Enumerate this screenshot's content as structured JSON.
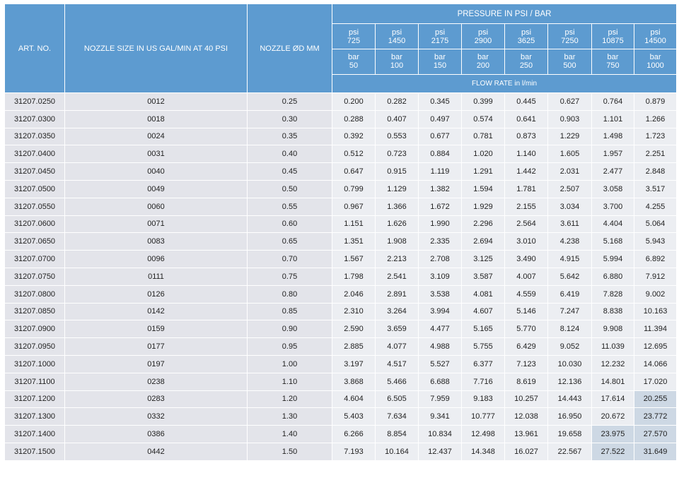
{
  "table": {
    "headers": {
      "art_no": "ART. NO.",
      "nozzle_size": "NOZZLE SIZE IN US GAL/MIN AT 40 PSI",
      "nozzle_diameter": "NOZZLE ØD MM",
      "pressure_group": "PRESSURE IN PSI / BAR",
      "flow_rate": "FLOW RATE in l/min"
    },
    "unit_psi": "psi",
    "unit_bar": "bar",
    "psi_values": [
      "725",
      "1450",
      "2175",
      "2900",
      "3625",
      "7250",
      "10875",
      "14500"
    ],
    "bar_values": [
      "50",
      "100",
      "150",
      "200",
      "250",
      "500",
      "750",
      "1000"
    ],
    "rows": [
      {
        "art": "31207.0250",
        "size": "0012",
        "dia": "0.25",
        "flows": [
          "0.200",
          "0.282",
          "0.345",
          "0.399",
          "0.445",
          "0.627",
          "0.764",
          "0.879"
        ]
      },
      {
        "art": "31207.0300",
        "size": "0018",
        "dia": "0.30",
        "flows": [
          "0.288",
          "0.407",
          "0.497",
          "0.574",
          "0.641",
          "0.903",
          "1.101",
          "1.266"
        ]
      },
      {
        "art": "31207.0350",
        "size": "0024",
        "dia": "0.35",
        "flows": [
          "0.392",
          "0.553",
          "0.677",
          "0.781",
          "0.873",
          "1.229",
          "1.498",
          "1.723"
        ]
      },
      {
        "art": "31207.0400",
        "size": "0031",
        "dia": "0.40",
        "flows": [
          "0.512",
          "0.723",
          "0.884",
          "1.020",
          "1.140",
          "1.605",
          "1.957",
          "2.251"
        ]
      },
      {
        "art": "31207.0450",
        "size": "0040",
        "dia": "0.45",
        "flows": [
          "0.647",
          "0.915",
          "1.119",
          "1.291",
          "1.442",
          "2.031",
          "2.477",
          "2.848"
        ]
      },
      {
        "art": "31207.0500",
        "size": "0049",
        "dia": "0.50",
        "flows": [
          "0.799",
          "1.129",
          "1.382",
          "1.594",
          "1.781",
          "2.507",
          "3.058",
          "3.517"
        ]
      },
      {
        "art": "31207.0550",
        "size": "0060",
        "dia": "0.55",
        "flows": [
          "0.967",
          "1.366",
          "1.672",
          "1.929",
          "2.155",
          "3.034",
          "3.700",
          "4.255"
        ]
      },
      {
        "art": "31207.0600",
        "size": "0071",
        "dia": "0.60",
        "flows": [
          "1.151",
          "1.626",
          "1.990",
          "2.296",
          "2.564",
          "3.611",
          "4.404",
          "5.064"
        ]
      },
      {
        "art": "31207.0650",
        "size": "0083",
        "dia": "0.65",
        "flows": [
          "1.351",
          "1.908",
          "2.335",
          "2.694",
          "3.010",
          "4.238",
          "5.168",
          "5.943"
        ]
      },
      {
        "art": "31207.0700",
        "size": "0096",
        "dia": "0.70",
        "flows": [
          "1.567",
          "2.213",
          "2.708",
          "3.125",
          "3.490",
          "4.915",
          "5.994",
          "6.892"
        ]
      },
      {
        "art": "31207.0750",
        "size": "0111",
        "dia": "0.75",
        "flows": [
          "1.798",
          "2.541",
          "3.109",
          "3.587",
          "4.007",
          "5.642",
          "6.880",
          "7.912"
        ]
      },
      {
        "art": "31207.0800",
        "size": "0126",
        "dia": "0.80",
        "flows": [
          "2.046",
          "2.891",
          "3.538",
          "4.081",
          "4.559",
          "6.419",
          "7.828",
          "9.002"
        ]
      },
      {
        "art": "31207.0850",
        "size": "0142",
        "dia": "0.85",
        "flows": [
          "2.310",
          "3.264",
          "3.994",
          "4.607",
          "5.146",
          "7.247",
          "8.838",
          "10.163"
        ]
      },
      {
        "art": "31207.0900",
        "size": "0159",
        "dia": "0.90",
        "flows": [
          "2.590",
          "3.659",
          "4.477",
          "5.165",
          "5.770",
          "8.124",
          "9.908",
          "11.394"
        ]
      },
      {
        "art": "31207.0950",
        "size": "0177",
        "dia": "0.95",
        "flows": [
          "2.885",
          "4.077",
          "4.988",
          "5.755",
          "6.429",
          "9.052",
          "11.039",
          "12.695"
        ]
      },
      {
        "art": "31207.1000",
        "size": "0197",
        "dia": "1.00",
        "flows": [
          "3.197",
          "4.517",
          "5.527",
          "6.377",
          "7.123",
          "10.030",
          "12.232",
          "14.066"
        ]
      },
      {
        "art": "31207.1100",
        "size": "0238",
        "dia": "1.10",
        "flows": [
          "3.868",
          "5.466",
          "6.688",
          "7.716",
          "8.619",
          "12.136",
          "14.801",
          "17.020"
        ]
      },
      {
        "art": "31207.1200",
        "size": "0283",
        "dia": "1.20",
        "flows": [
          "4.604",
          "6.505",
          "7.959",
          "9.183",
          "10.257",
          "14.443",
          "17.614",
          "20.255"
        ]
      },
      {
        "art": "31207.1300",
        "size": "0332",
        "dia": "1.30",
        "flows": [
          "5.403",
          "7.634",
          "9.341",
          "10.777",
          "12.038",
          "16.950",
          "20.672",
          "23.772"
        ]
      },
      {
        "art": "31207.1400",
        "size": "0386",
        "dia": "1.40",
        "flows": [
          "6.266",
          "8.854",
          "10.834",
          "12.498",
          "13.961",
          "19.658",
          "23.975",
          "27.570"
        ]
      },
      {
        "art": "31207.1500",
        "size": "0442",
        "dia": "1.50",
        "flows": [
          "7.193",
          "10.164",
          "12.437",
          "14.348",
          "16.027",
          "22.567",
          "27.522",
          "31.649"
        ]
      }
    ],
    "highlighted_cells": [
      {
        "row": 17,
        "col": 7
      },
      {
        "row": 18,
        "col": 7
      },
      {
        "row": 19,
        "col": 6
      },
      {
        "row": 19,
        "col": 7
      },
      {
        "row": 20,
        "col": 6
      },
      {
        "row": 20,
        "col": 7
      }
    ],
    "colors": {
      "header_bg": "#5d9bd0",
      "header_text": "#ffffff",
      "body_left_bg": "#e3e4ea",
      "body_value_bg": "#eceef2",
      "highlight_bg": "#cdd8e4"
    }
  }
}
